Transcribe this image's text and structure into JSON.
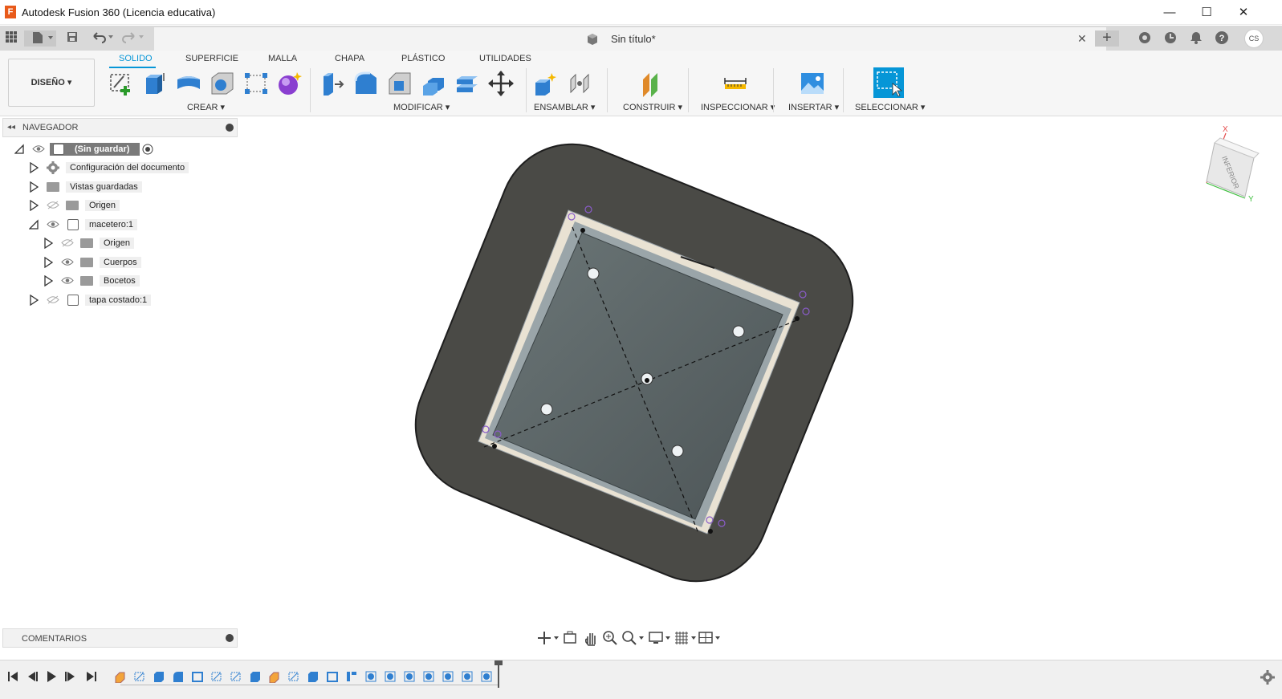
{
  "window": {
    "title": "Autodesk Fusion 360 (Licencia educativa)",
    "logo_letter": "F",
    "minimize": "—",
    "maximize": "☐",
    "close": "✕"
  },
  "document": {
    "title": "Sin título*",
    "tab_close": "✕",
    "user_initials": "CS"
  },
  "ribbon": {
    "workspace": "DISEÑO ▾",
    "tabs": [
      "SOLIDO",
      "SUPERFICIE",
      "MALLA",
      "CHAPA",
      "PLÁSTICO",
      "UTILIDADES"
    ],
    "active_tab": "SOLIDO",
    "groups": [
      "CREAR ▾",
      "MODIFICAR ▾",
      "ENSAMBLAR ▾",
      "CONSTRUIR ▾",
      "INSPECCIONAR ▾",
      "INSERTAR ▾",
      "SELECCIONAR ▾"
    ],
    "accent": "#0696d7"
  },
  "navigator": {
    "title": "NAVEGADOR",
    "items": [
      {
        "label": "(Sin guardar)"
      },
      {
        "label": "Configuración del documento"
      },
      {
        "label": "Vistas guardadas"
      },
      {
        "label": "Origen"
      },
      {
        "label": "macetero:1"
      },
      {
        "label": "Origen"
      },
      {
        "label": "Cuerpos"
      },
      {
        "label": "Bocetos"
      },
      {
        "label": "tapa costado:1"
      }
    ]
  },
  "comments": {
    "title": "COMENTARIOS"
  },
  "viewcube": {
    "face": "INFERIOR",
    "axis_x": "X",
    "axis_y": "Y"
  }
}
